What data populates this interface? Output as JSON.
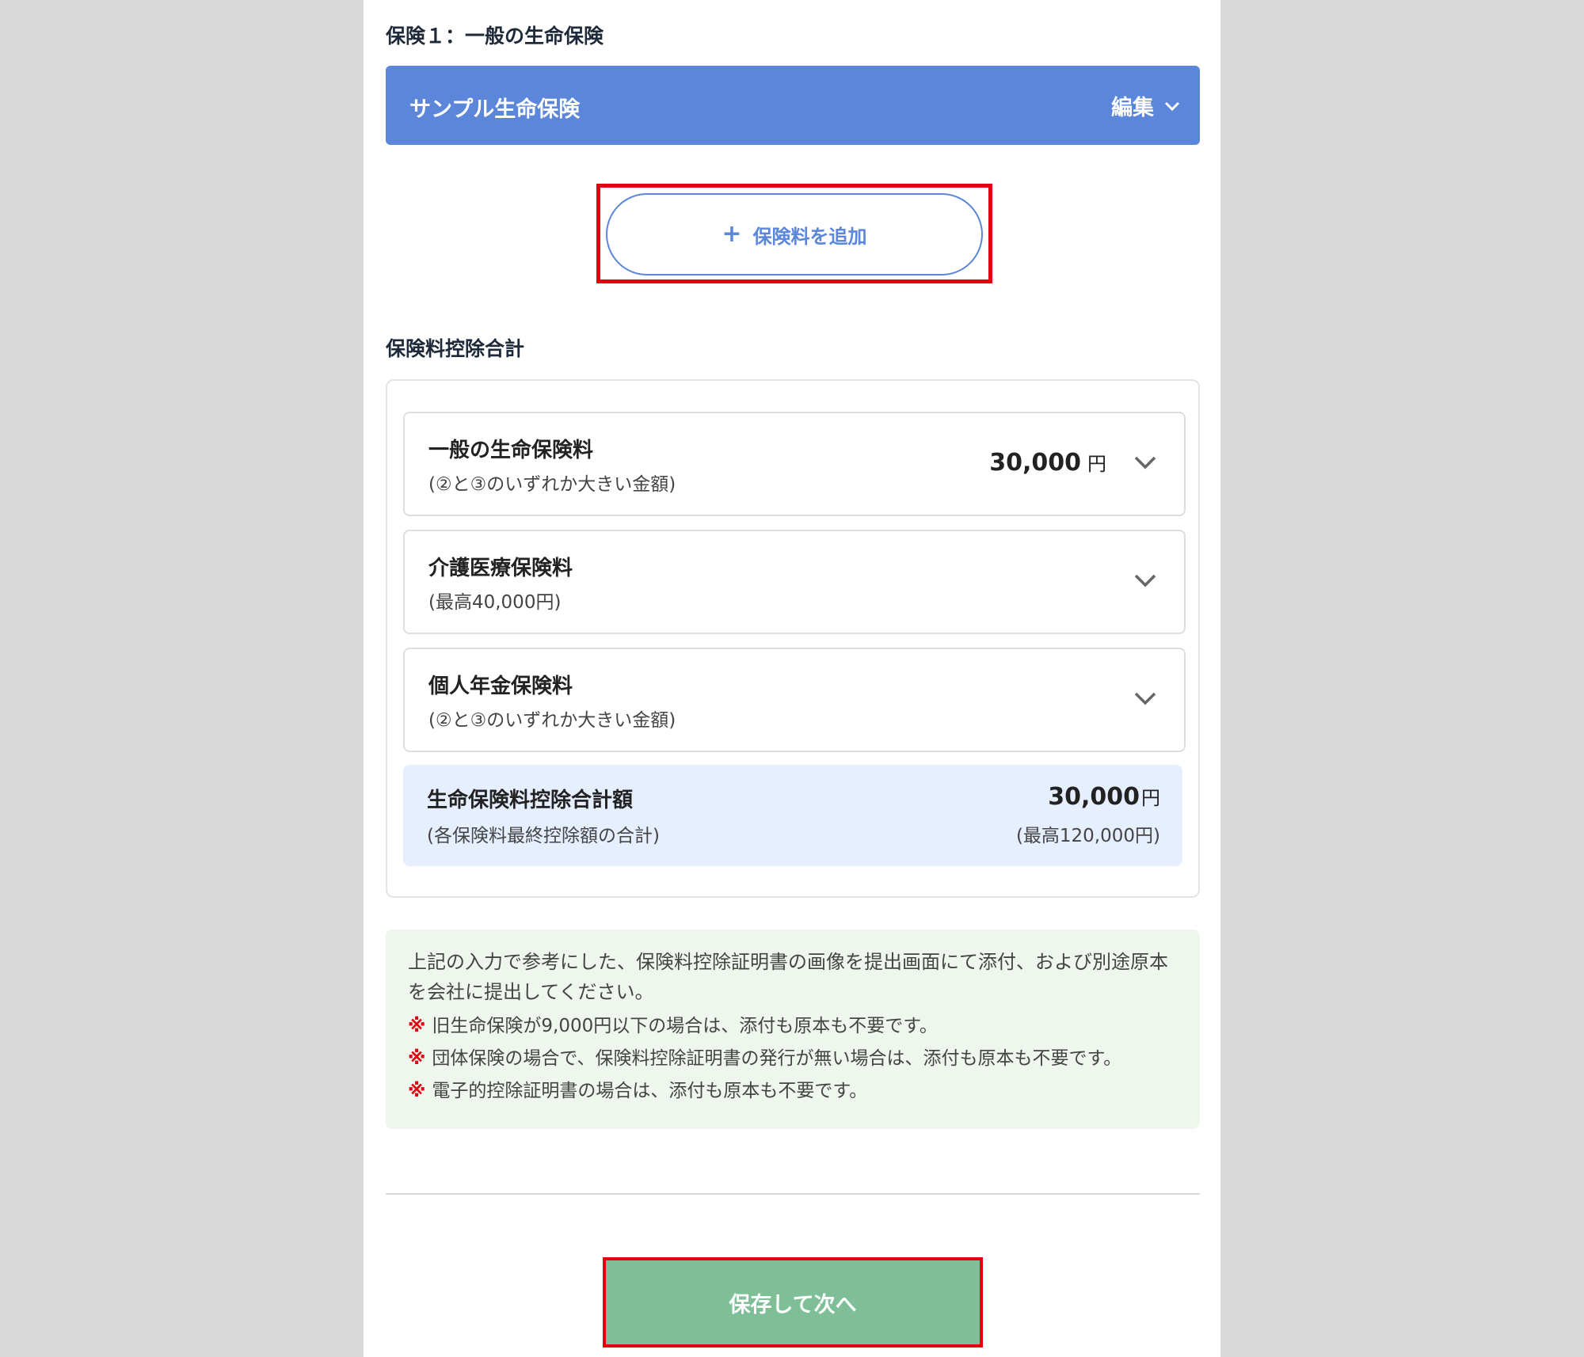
{
  "insurance_section": {
    "title": "保険１：一般の生命保険",
    "header_name": "サンプル生命保険",
    "edit_label": "編集",
    "add_premium_label": "保険料を追加"
  },
  "deduction_total": {
    "title": "保険料控除合計",
    "rows": [
      {
        "label": "一般の生命保険料",
        "sub": "(②と③のいずれか大きい金額)",
        "amount": "30,000",
        "unit": "円"
      },
      {
        "label": "介護医療保険料",
        "sub": "(最高40,000円)",
        "amount": "",
        "unit": ""
      },
      {
        "label": "個人年金保険料",
        "sub": "(②と③のいずれか大きい金額)",
        "amount": "",
        "unit": ""
      }
    ],
    "total": {
      "label": "生命保険料控除合計額",
      "sub": "(各保険料最終控除額の合計)",
      "amount": "30,000",
      "unit": "円",
      "max": "(最高120,000円)"
    }
  },
  "notice": {
    "main": "上記の入力で参考にした、保険料控除証明書の画像を提出画面にて添付、および別途原本を会社に提出してください。",
    "mark": "※",
    "notes": [
      "旧生命保険が9,000円以下の場合は、添付も原本も不要です。",
      "団体保険の場合で、保険料控除証明書の発行が無い場合は、添付も原本も不要です。",
      "電子的控除証明書の場合は、添付も原本も不要です。"
    ]
  },
  "save_button_label": "保存して次へ",
  "colors": {
    "header_blue": "#5b86da",
    "save_green": "#7fbf98",
    "highlight_red": "#e3000f",
    "total_bg": "#e6efff",
    "notice_bg": "#eef6ee"
  },
  "icons": {
    "edit_chevron": "chevron-down-icon",
    "row_chevron": "chevron-down-icon",
    "add": "plus-icon"
  }
}
